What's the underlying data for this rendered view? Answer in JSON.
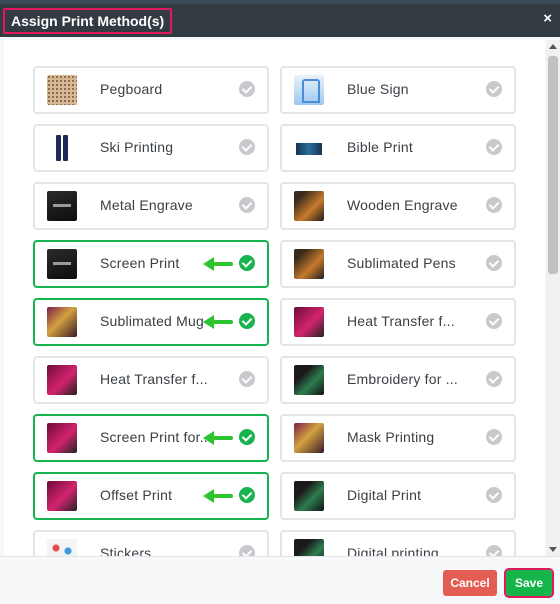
{
  "dialog": {
    "title": "Assign Print Method(s)",
    "close_glyph": "×"
  },
  "methods": [
    {
      "label": "Pegboard",
      "selected": false,
      "thumb": "pegboard-image"
    },
    {
      "label": "Blue Sign",
      "selected": false,
      "thumb": "blue-sign-image"
    },
    {
      "label": "Ski Printing",
      "selected": false,
      "thumb": "ski-printing-image"
    },
    {
      "label": "Bible Print",
      "selected": false,
      "thumb": "bible-print-image"
    },
    {
      "label": "Metal Engrave",
      "selected": false,
      "thumb": "metal-engrave-image"
    },
    {
      "label": "Wooden Engrave",
      "selected": false,
      "thumb": "wooden-engrave-image"
    },
    {
      "label": "Screen Print",
      "selected": true,
      "thumb": "screen-print-image"
    },
    {
      "label": "Sublimated Pens",
      "selected": false,
      "thumb": "sublimated-pens-image"
    },
    {
      "label": "Sublimated Mug",
      "selected": true,
      "thumb": "sublimated-mug-image"
    },
    {
      "label": "Heat Transfer f...",
      "selected": false,
      "thumb": "heat-transfer-image"
    },
    {
      "label": "Heat Transfer f...",
      "selected": false,
      "thumb": "heat-transfer-image"
    },
    {
      "label": "Embroidery for ...",
      "selected": false,
      "thumb": "embroidery-image"
    },
    {
      "label": "Screen Print for...",
      "selected": true,
      "thumb": "screen-print-for-image"
    },
    {
      "label": "Mask Printing",
      "selected": false,
      "thumb": "mask-printing-image"
    },
    {
      "label": "Offset Print",
      "selected": true,
      "thumb": "offset-print-image"
    },
    {
      "label": "Digital Print",
      "selected": false,
      "thumb": "digital-print-image"
    },
    {
      "label": "Stickers",
      "selected": false,
      "thumb": "stickers-image"
    },
    {
      "label": "Digital printing",
      "selected": false,
      "thumb": "digital-printing-image"
    }
  ],
  "footer": {
    "cancel_label": "Cancel",
    "save_label": "Save"
  },
  "colors": {
    "header_bg": "#323a42",
    "highlight": "#e0195f",
    "selected_border": "#17b34d",
    "cancel_bg": "#e35d52",
    "save_bg": "#16b54b",
    "annotation_arrow": "#2ac52f"
  }
}
